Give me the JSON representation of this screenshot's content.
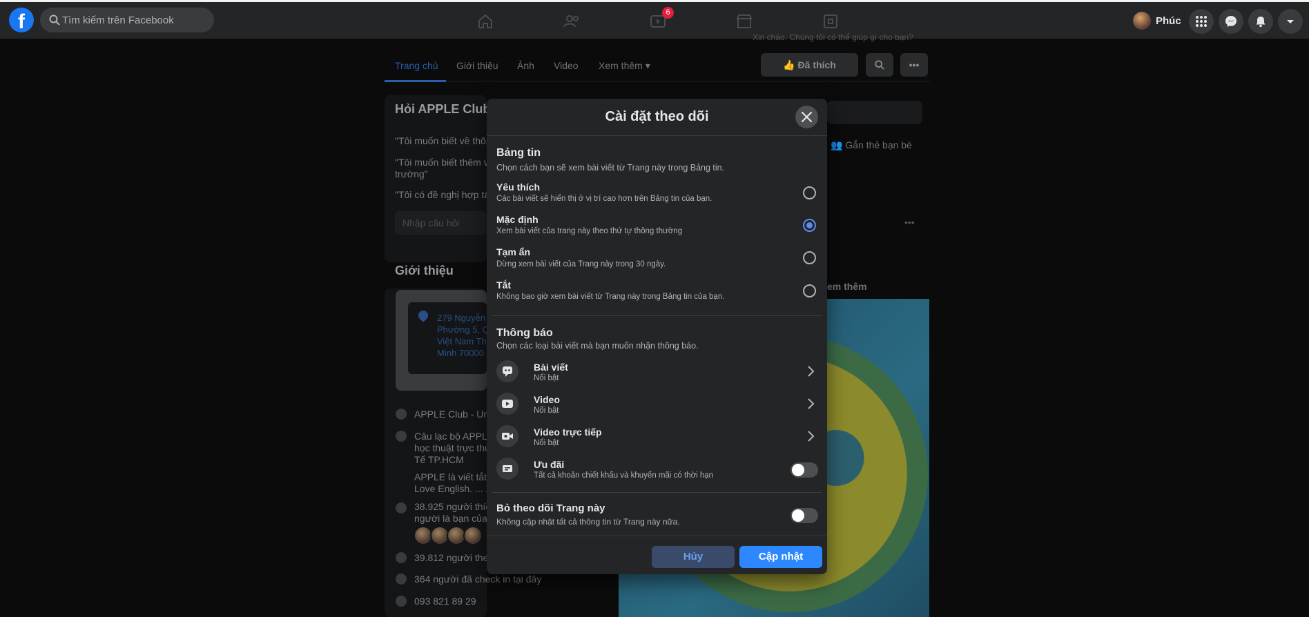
{
  "topbar": {
    "logo": "f",
    "search_placeholder": "Tìm kiếm trên Facebook",
    "video_badge": "6",
    "profile_name": "Phúc"
  },
  "page": {
    "header_snippet": "Xin chào. Chúng tôi có thể giúp gì cho bạn?",
    "tabs": [
      "Trang chủ",
      "Giới thiệu",
      "Ảnh",
      "Video",
      "Xem thêm ▾"
    ],
    "liked_button": "Đã thích",
    "ask_title": "Hỏi APPLE Club",
    "ask_items": [
      "\"Tôi muốn biết về thôn",
      "\"Tôi muốn biết thêm v",
      "trường\"",
      "\"Tôi có đề nghị hợp tá"
    ],
    "ask_input": "Nhập câu hỏi",
    "tag_friends": "Gắn thẻ bạn bè",
    "see_more": "em thêm",
    "intro_title": "Giới thiệu",
    "address_lines": [
      "279 Nguyễn",
      "Phường 5, Q",
      "Việt Nam Th",
      "Minh 70000"
    ],
    "about_items": [
      "APPLE Club - Univ",
      "Câu lạc bộ APPLE",
      "học thuật trực thu",
      "Tế TP.HCM",
      "APPLE là viết tắt c",
      "Love English. ... X",
      "38.925 người thíc",
      "người là bạn của",
      "39.812 người theo",
      "364 người đã check in tại đây",
      "093 821 89 29"
    ]
  },
  "modal": {
    "title": "Cài đặt theo dõi",
    "newsfeed": {
      "title": "Bảng tin",
      "desc": "Chọn cách bạn sẽ xem bài viết từ Trang này trong Bảng tin.",
      "options": [
        {
          "label": "Yêu thích",
          "desc": "Các bài viết sẽ hiển thị ở vị trí cao hơn trên Bảng tin của bạn.",
          "checked": false
        },
        {
          "label": "Mặc định",
          "desc": "Xem bài viết của trang này theo thứ tự thông thường",
          "checked": true
        },
        {
          "label": "Tạm ẩn",
          "desc": "Dừng xem bài viết của Trang này trong 30 ngày.",
          "checked": false
        },
        {
          "label": "Tắt",
          "desc": "Không bao giờ xem bài viết từ Trang này trong Bảng tin của bạn.",
          "checked": false
        }
      ]
    },
    "notifications": {
      "title": "Thông báo",
      "desc": "Chọn các loại bài viết mà bạn muốn nhận thông báo.",
      "items": [
        {
          "label": "Bài viết",
          "sub": "Nổi bật",
          "icon": "post-icon"
        },
        {
          "label": "Video",
          "sub": "Nổi bật",
          "icon": "video-icon"
        },
        {
          "label": "Video trực tiếp",
          "sub": "Nổi bật",
          "icon": "live-video-icon"
        },
        {
          "label": "Ưu đãi",
          "sub": "Tất cả khoản chiết khấu và khuyến mãi có thời hạn",
          "icon": "offer-icon",
          "toggle_on": false
        }
      ]
    },
    "unfollow": {
      "title": "Bỏ theo dõi Trang này",
      "desc": "Không cập nhật tất cả thông tin từ Trang này nữa.",
      "toggle_on": false
    },
    "cancel_label": "Hủy",
    "update_label": "Cập nhật"
  },
  "colors": {
    "accent": "#2d88ff",
    "surface": "#242526",
    "background": "#0b0b0b"
  }
}
